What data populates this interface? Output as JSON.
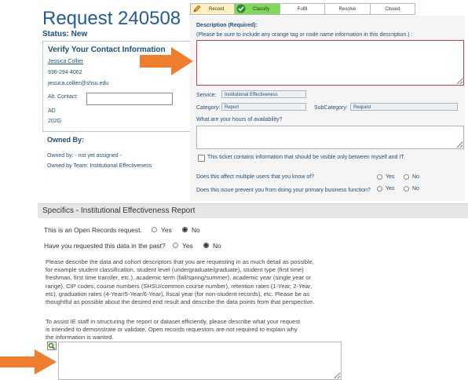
{
  "ticket": {
    "title": "Request 240508",
    "status": "Status: New"
  },
  "contact": {
    "heading": "Verify Your Contact Information",
    "name": "Jessica Collier",
    "phone": "936-294-4062",
    "email": "jessica.collier@shsu.edu",
    "alt_contact_label": "Alt. Contact:",
    "alt_contact_value": "",
    "building": "AD",
    "room": "202G"
  },
  "owned": {
    "heading": "Owned By:",
    "owned_by": "Owned by: - not yet assigned -",
    "owned_by_team": "Owned by Team: Institutional Effectiveness"
  },
  "stepper": {
    "steps": [
      "Record",
      "Classify",
      "Fulfil",
      "Resolve",
      "Closed"
    ]
  },
  "form": {
    "description_label": "Description (Required):",
    "description_hint": "(Please be sure to include any orange tag or node name information in this description.) :",
    "description_value": "",
    "service_label": "Service:",
    "service_value": "Institutional Effectiveness",
    "category_label": "Category:",
    "category_value": "Report",
    "subcategory_label": "SubCategory:",
    "subcategory_value": "Request",
    "hours_label": "What are your hours of availability?",
    "hours_value": "",
    "visible_checkbox_label": "This ticket contains information that should be visible only between myself and IT.",
    "multi_users_question": "Does this affect multiple users that you know of?",
    "business_question": "Does this issue prevent you from doing your primary business function?",
    "yes": "Yes",
    "no": "No"
  },
  "specifics": {
    "title": "Specifics - Institutional Effectiveness Report",
    "open_records_question": "This is an Open Records request.",
    "open_records_selected": "No",
    "requested_past_question": "Have you requested this data in the past?",
    "requested_past_selected": "No",
    "yes": "Yes",
    "no": "No",
    "paragraph1": [
      "Please describe the data and cohort descriptors that you are requesting in as much detail as possible,",
      "for example student classification, student level (undergraduate/graduate), student type (first time)",
      "freshman, first time transfer, etc.), academic term (fall/spring/summer), academic year (single year or",
      "range), CIP codes, course numbers (SHSU/common course number), retention rates (1-Year, 2-Year,",
      "etc), graduation rates (4-Year/5-Year/6-Year), fiscal year (for non-student records), etc. Please be as",
      "thoughtful as possible about the desired end result and describe the data points from that perspective."
    ],
    "paragraph2": [
      "To assist IE staff in structuring the report or dataset efficiently, please describe what your request",
      "is intended to demonstrate or validate. Open records requestors are not required to explain why",
      "the information is wanted."
    ],
    "request_value": ""
  },
  "colors": {
    "accent": "#1f5c99",
    "arrow": "#ee7d2e",
    "classify_green": "#7ed957",
    "required_border": "#d04040"
  }
}
